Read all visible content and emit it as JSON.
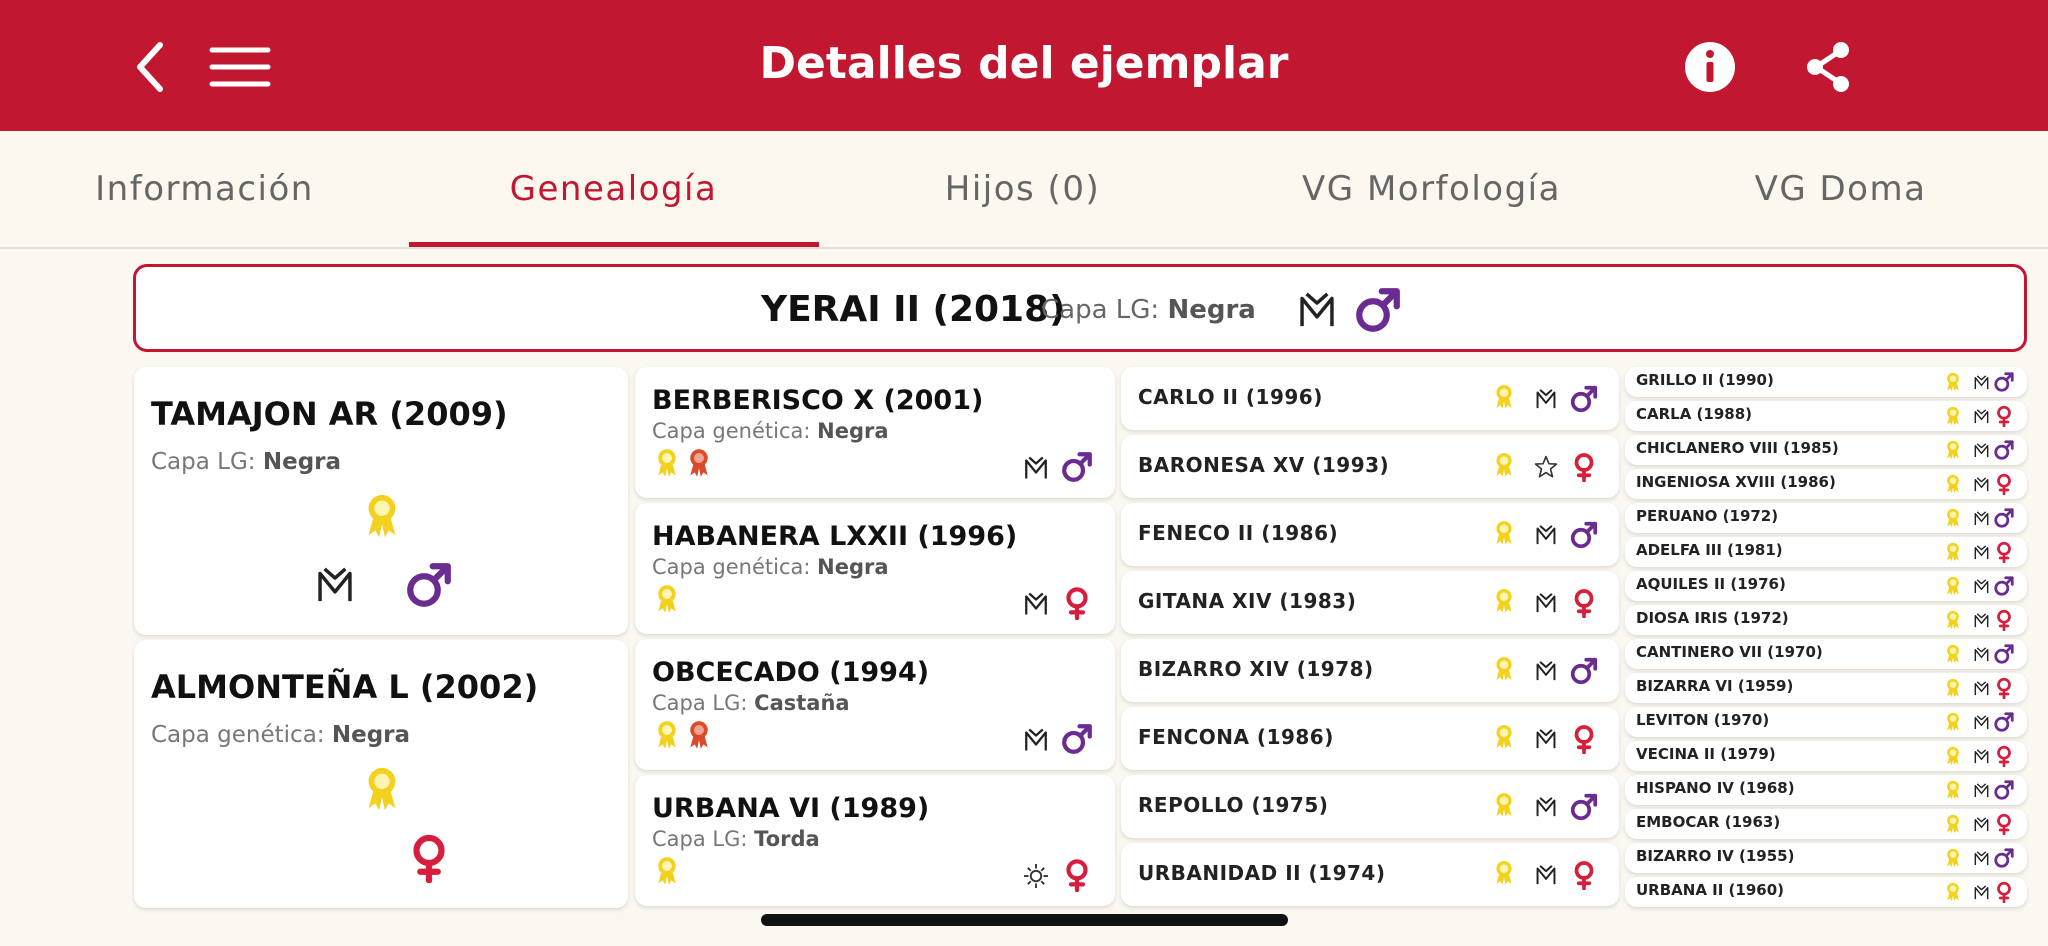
{
  "app": {
    "title": "Detalles del ejemplar"
  },
  "tabs": [
    {
      "label": "Información",
      "active": false
    },
    {
      "label": "Genealogía",
      "active": true
    },
    {
      "label": "Hijos (0)",
      "active": false
    },
    {
      "label": "VG Morfología",
      "active": false
    },
    {
      "label": "VG Doma",
      "active": false
    }
  ],
  "subject": {
    "name": "YERAI II (2018)",
    "capa_label": "Capa LG:",
    "capa_value": "Negra",
    "icons": [
      "brand-mark-icon",
      "male-icon"
    ]
  },
  "gen1": [
    {
      "name": "TAMAJON AR (2009)",
      "capa_label": "Capa LG:",
      "capa_value": "Negra",
      "icons": [
        "medal-icon",
        "brand-mark-icon",
        "male-icon"
      ]
    },
    {
      "name": "ALMONTEÑA L (2002)",
      "capa_label": "Capa genética:",
      "capa_value": "Negra",
      "icons": [
        "medal-icon",
        "female-icon"
      ]
    }
  ],
  "gen2": [
    {
      "name": "BERBERISCO X (2001)",
      "capa_label": "Capa genética:",
      "capa_value": "Negra",
      "icons": [
        "medal-icon",
        "red-medal-icon",
        "brand-mark-icon",
        "male-icon"
      ]
    },
    {
      "name": "HABANERA LXXII (1996)",
      "capa_label": "Capa genética:",
      "capa_value": "Negra",
      "icons": [
        "medal-icon",
        "brand-mark-icon",
        "female-icon"
      ]
    },
    {
      "name": "OBCECADO (1994)",
      "capa_label": "Capa LG:",
      "capa_value": "Castaña",
      "icons": [
        "medal-icon",
        "red-medal-icon",
        "brand-mark-icon",
        "male-icon"
      ]
    },
    {
      "name": "URBANA VI (1989)",
      "capa_label": "Capa LG:",
      "capa_value": "Torda",
      "icons": [
        "medal-icon",
        "sun-brand-icon",
        "female-icon"
      ]
    }
  ],
  "gen3": [
    {
      "name": "CARLO II (1996)",
      "sex": "male"
    },
    {
      "name": "BARONESA XV (1993)",
      "sex": "female"
    },
    {
      "name": "FENECO II (1986)",
      "sex": "male"
    },
    {
      "name": "GITANA XIV (1983)",
      "sex": "female"
    },
    {
      "name": "BIZARRO XIV (1978)",
      "sex": "male"
    },
    {
      "name": "FENCONA (1986)",
      "sex": "female"
    },
    {
      "name": "REPOLLO (1975)",
      "sex": "male"
    },
    {
      "name": "URBANIDAD II (1974)",
      "sex": "female"
    }
  ],
  "gen4": [
    {
      "name": "GRILLO II (1990)",
      "sex": "male"
    },
    {
      "name": "CARLA (1988)",
      "sex": "female"
    },
    {
      "name": "CHICLANERO VIII (1985)",
      "sex": "male"
    },
    {
      "name": "INGENIOSA XVIII (1986)",
      "sex": "female"
    },
    {
      "name": "PERUANO (1972)",
      "sex": "male"
    },
    {
      "name": "ADELFA III (1981)",
      "sex": "female"
    },
    {
      "name": "AQUILES II (1976)",
      "sex": "male"
    },
    {
      "name": "DIOSA IRIS (1972)",
      "sex": "female"
    },
    {
      "name": "CANTINERO VII (1970)",
      "sex": "male"
    },
    {
      "name": "BIZARRA VI (1959)",
      "sex": "female"
    },
    {
      "name": "LEVITON (1970)",
      "sex": "male"
    },
    {
      "name": "VECINA II (1979)",
      "sex": "female"
    },
    {
      "name": "HISPANO IV (1968)",
      "sex": "male"
    },
    {
      "name": "EMBOCAR (1963)",
      "sex": "female"
    },
    {
      "name": "BIZARRO IV (1955)",
      "sex": "male"
    },
    {
      "name": "URBANA II (1960)",
      "sex": "female"
    }
  ],
  "colors": {
    "brand": "#c21731",
    "male": "#6a2c91",
    "female": "#d71e3c",
    "medal": "#f2d21e",
    "red_medal": "#d94c2b"
  }
}
